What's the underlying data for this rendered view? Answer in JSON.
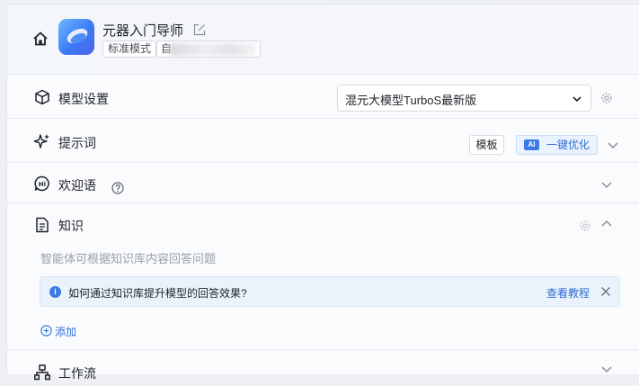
{
  "header": {
    "bot_name": "元器入门导师",
    "mode_tag": "标准模式",
    "blurred_tag_prefix": "自"
  },
  "sections": {
    "model": {
      "title": "模型设置",
      "selected_model": "混元大模型TurboS最新版"
    },
    "prompt": {
      "title": "提示词",
      "template_label": "模板",
      "ai_badge": "AI",
      "optimize_label": "一键优化"
    },
    "welcome": {
      "title": "欢迎语"
    },
    "knowledge": {
      "title": "知识",
      "description": "智能体可根据知识库内容回答问题",
      "tip_text": "如何通过知识库提升模型的回答效果?",
      "tip_link": "查看教程",
      "add_label": "添加"
    },
    "workflow": {
      "title": "工作流"
    }
  },
  "colors": {
    "accent": "#2f6fd6",
    "tip_background": "#eaf2fb",
    "panel_background": "#fafbfd"
  }
}
